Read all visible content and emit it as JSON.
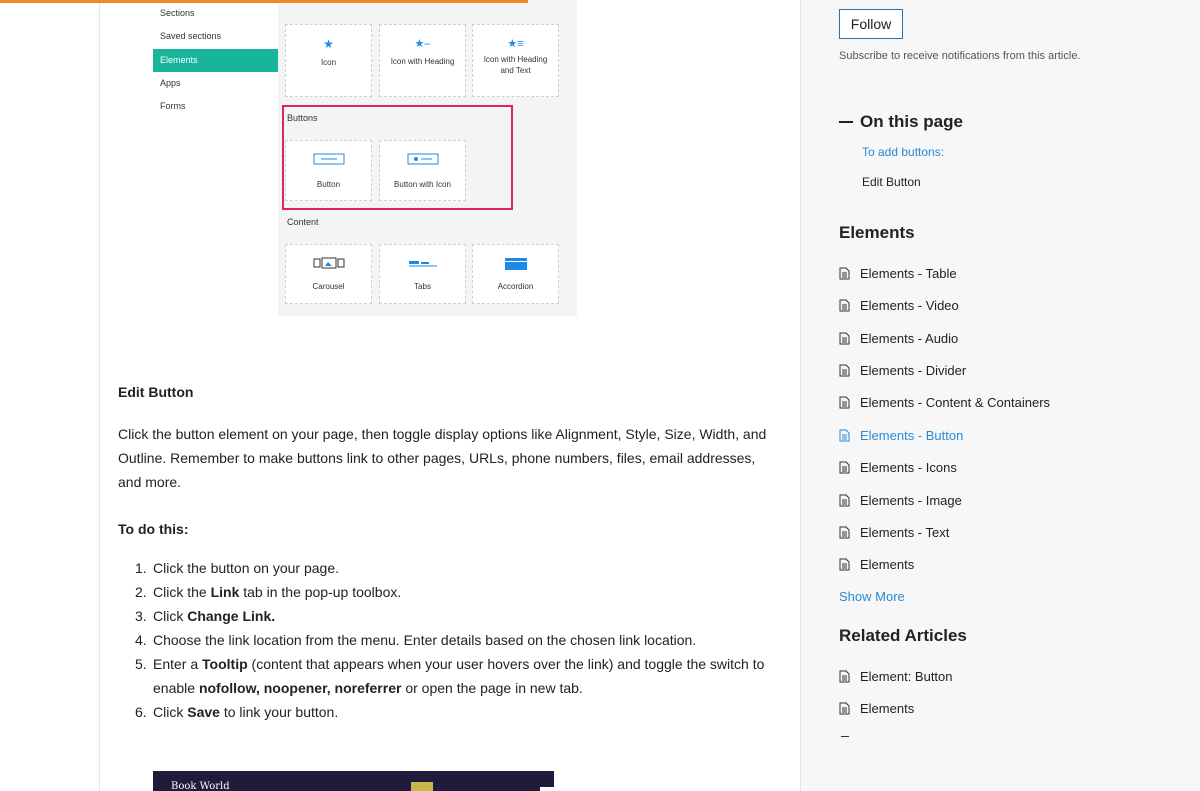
{
  "screenshot": {
    "nav": [
      "Sections",
      "Saved sections",
      "Elements",
      "Apps",
      "Forms"
    ],
    "icons_tiles": [
      "Icon",
      "Icon with Heading",
      "Icon with Heading and Text"
    ],
    "buttons_heading": "Buttons",
    "buttons_tiles": [
      "Button",
      "Button with Icon"
    ],
    "content_heading": "Content",
    "content_tiles": [
      "Carousel",
      "Tabs",
      "Accordion"
    ]
  },
  "article": {
    "edit_heading": "Edit Button",
    "paragraph": "Click the button element on your page, then toggle display options like Alignment, Style, Size, Width, and Outline. Remember to make buttons link to other pages, URLs, phone numbers, files, email addresses, and more.",
    "todo_heading": "To do this:",
    "steps": {
      "s1": "Click the button on your page.",
      "s2_a": "Click the ",
      "s2_b": "Link",
      "s2_c": " tab in the pop-up toolbox.",
      "s3_a": "Click ",
      "s3_b": "Change Link.",
      "s4": "Choose the link location from the menu. Enter details based on the chosen link location.",
      "s5_a": "Enter a ",
      "s5_b": "Tooltip",
      "s5_c": " (content that appears when your user hovers over the link) and toggle the switch to enable ",
      "s5_d": "nofollow, noopener, noreferrer",
      "s5_e": " or open the page in new tab.",
      "s6_a": "Click ",
      "s6_b": "Save",
      "s6_c": " to link your button."
    },
    "banner_title": "Book World"
  },
  "sidebar": {
    "follow_label": "Follow",
    "subscribe_text": "Subscribe to receive notifications from this article.",
    "on_this_page": "On this page",
    "otp_links": [
      "To add buttons:",
      "Edit Button"
    ],
    "elements_heading": "Elements",
    "elements_items": [
      "Elements - Table",
      "Elements - Video",
      "Elements - Audio",
      "Elements - Divider",
      "Elements - Content & Containers",
      "Elements - Button",
      "Elements - Icons",
      "Elements - Image",
      "Elements - Text",
      "Elements"
    ],
    "show_more": "Show More",
    "related_heading": "Related Articles",
    "related_items": [
      "Element: Button",
      "Elements"
    ]
  },
  "colors": {
    "accent": "#2a8ad4",
    "progress": "#f08a24",
    "highlight": "#e0245e",
    "active_nav": "#19b49c"
  },
  "reading_progress": 0.44
}
